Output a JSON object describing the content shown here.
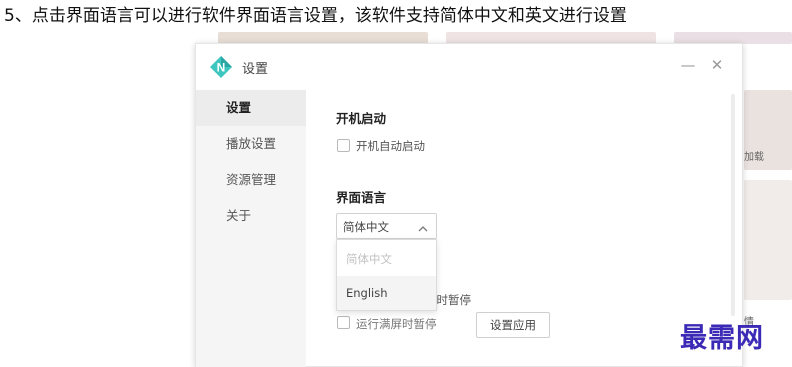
{
  "caption": "5、点击界面语言可以进行软件界面语言设置，该软件支持简体中文和英文进行设置",
  "dialog": {
    "title": "设置",
    "minimize_glyph": "—",
    "close_glyph": "✕",
    "logo_letter": "N",
    "accent_color": "#3ec6c1"
  },
  "sidebar": {
    "items": [
      {
        "label": "设置",
        "active": true
      },
      {
        "label": "播放设置",
        "active": false
      },
      {
        "label": "资源管理",
        "active": false
      },
      {
        "label": "关于",
        "active": false
      }
    ]
  },
  "startup": {
    "title": "开机启动",
    "checkbox_label": "开机自动启动",
    "checked": false
  },
  "language": {
    "title": "界面语言",
    "selected": "简体中文",
    "options": [
      {
        "label": "简体中文",
        "disabled": true
      },
      {
        "label": "English",
        "disabled": false
      }
    ]
  },
  "pause": {
    "partial_label_1": "随时暂停",
    "partial_label_2": "运行满屏时暂停",
    "apply_button": "设置应用"
  },
  "background_fragments": [
    "加载",
    "情"
  ],
  "watermark": "最需网"
}
